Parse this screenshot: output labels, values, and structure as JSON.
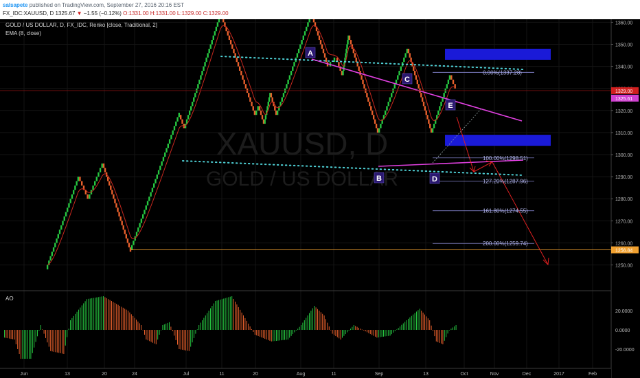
{
  "header": {
    "author": "salsapete",
    "published_text": " published on TradingView.com, September 27, 2016 20:16 EST",
    "symbol": "FX_IDC:XAUUSD, D",
    "last": "1325.67",
    "change_arrow": "▼",
    "change": "−1.55 (−0.12%)",
    "ohlc": "O:1331.00 H:1331.00 L:1329.00 C:1329.00"
  },
  "legend": {
    "main": "GOLD / US DOLLAR, D, FX_IDC, Renko [close, Traditional, 2]",
    "ema": "EMA (8, close)",
    "ao": "AO"
  },
  "watermark": {
    "symbol": "XAUUSD, D",
    "name": "GOLD / US DOLLAR"
  },
  "colors": {
    "up": "#26c640",
    "down": "#e8602c",
    "ema": "#c8281e",
    "channel": "#4fd1d6",
    "wedge": "#e040e0",
    "zone": "#1a1ad8",
    "support": "#f0a030",
    "projection": "#e02020",
    "bg": "#000000"
  },
  "chart_data": [
    {
      "type": "line",
      "title": "GOLD / US DOLLAR, D, FX_IDC, Renko [close, Traditional, 2]",
      "yaxis_ticks": [
        1250,
        1260,
        1270,
        1280,
        1290,
        1300,
        1310,
        1320,
        1330,
        1340,
        1350,
        1360,
        1370,
        1380
      ],
      "ylim": [
        1245,
        1385
      ],
      "xaxis_ticks": [
        "Jun",
        "13",
        "20",
        "24",
        "Jul",
        "11",
        "20",
        "Aug",
        "11",
        "Sep",
        "13",
        "Oct",
        "Nov",
        "Dec",
        "2017",
        "Feb"
      ],
      "renko_brick_size": 2,
      "renko_path": [
        1248,
        1290,
        1280,
        1296,
        1257,
        1318,
        1312,
        1364,
        1318,
        1322,
        1314,
        1328,
        1318,
        1364,
        1340,
        1344,
        1336,
        1354,
        1310,
        1348,
        1310,
        1336,
        1330
      ],
      "price_labels": [
        {
          "value": 1329.0,
          "text": "1329.00",
          "color": "#d02020"
        },
        {
          "value": 1325.61,
          "text": "1325.61",
          "color": "#d040d0"
        },
        {
          "value": 1256.84,
          "text": "1256.84",
          "color": "#f0a030"
        }
      ],
      "fibonacci": [
        {
          "label": "0.00%(1337.28)",
          "value": 1337.28
        },
        {
          "label": "100.00%(1298.51)",
          "value": 1298.51
        },
        {
          "label": "127.20%(1287.96)",
          "value": 1287.96
        },
        {
          "label": "161.80%(1274.55)",
          "value": 1274.55
        },
        {
          "label": "200.00%(1259.74)",
          "value": 1259.74
        }
      ],
      "pattern_points": [
        {
          "label": "A",
          "value": 1364
        },
        {
          "label": "B",
          "value": 1310
        },
        {
          "label": "C",
          "value": 1348
        },
        {
          "label": "D",
          "value": 1310
        },
        {
          "label": "E",
          "value": 1336
        }
      ],
      "zones": [
        {
          "top": 1348,
          "bottom": 1343
        },
        {
          "top": 1309,
          "bottom": 1304
        }
      ]
    },
    {
      "type": "bar",
      "title": "AO",
      "yaxis_ticks": [
        20,
        0,
        -20
      ],
      "ylim": [
        -33,
        33
      ],
      "anchors": [
        [
          0,
          -8
        ],
        [
          6,
          -10
        ],
        [
          10,
          -30
        ],
        [
          16,
          -30
        ],
        [
          22,
          5
        ],
        [
          28,
          -22
        ],
        [
          36,
          -25
        ],
        [
          40,
          10
        ],
        [
          50,
          32
        ],
        [
          60,
          35
        ],
        [
          75,
          20
        ],
        [
          83,
          5
        ],
        [
          86,
          -10
        ],
        [
          92,
          -15
        ],
        [
          96,
          5
        ],
        [
          100,
          8
        ],
        [
          106,
          -20
        ],
        [
          112,
          -22
        ],
        [
          118,
          5
        ],
        [
          128,
          30
        ],
        [
          138,
          35
        ],
        [
          144,
          18
        ],
        [
          152,
          -5
        ],
        [
          162,
          -12
        ],
        [
          172,
          -10
        ],
        [
          180,
          5
        ],
        [
          188,
          25
        ],
        [
          194,
          15
        ],
        [
          199,
          -4
        ],
        [
          204,
          -10
        ],
        [
          212,
          5
        ],
        [
          226,
          -8
        ],
        [
          234,
          -6
        ],
        [
          244,
          10
        ],
        [
          252,
          22
        ],
        [
          258,
          10
        ],
        [
          262,
          -12
        ],
        [
          266,
          -15
        ],
        [
          270,
          0
        ],
        [
          274,
          5
        ]
      ]
    }
  ]
}
